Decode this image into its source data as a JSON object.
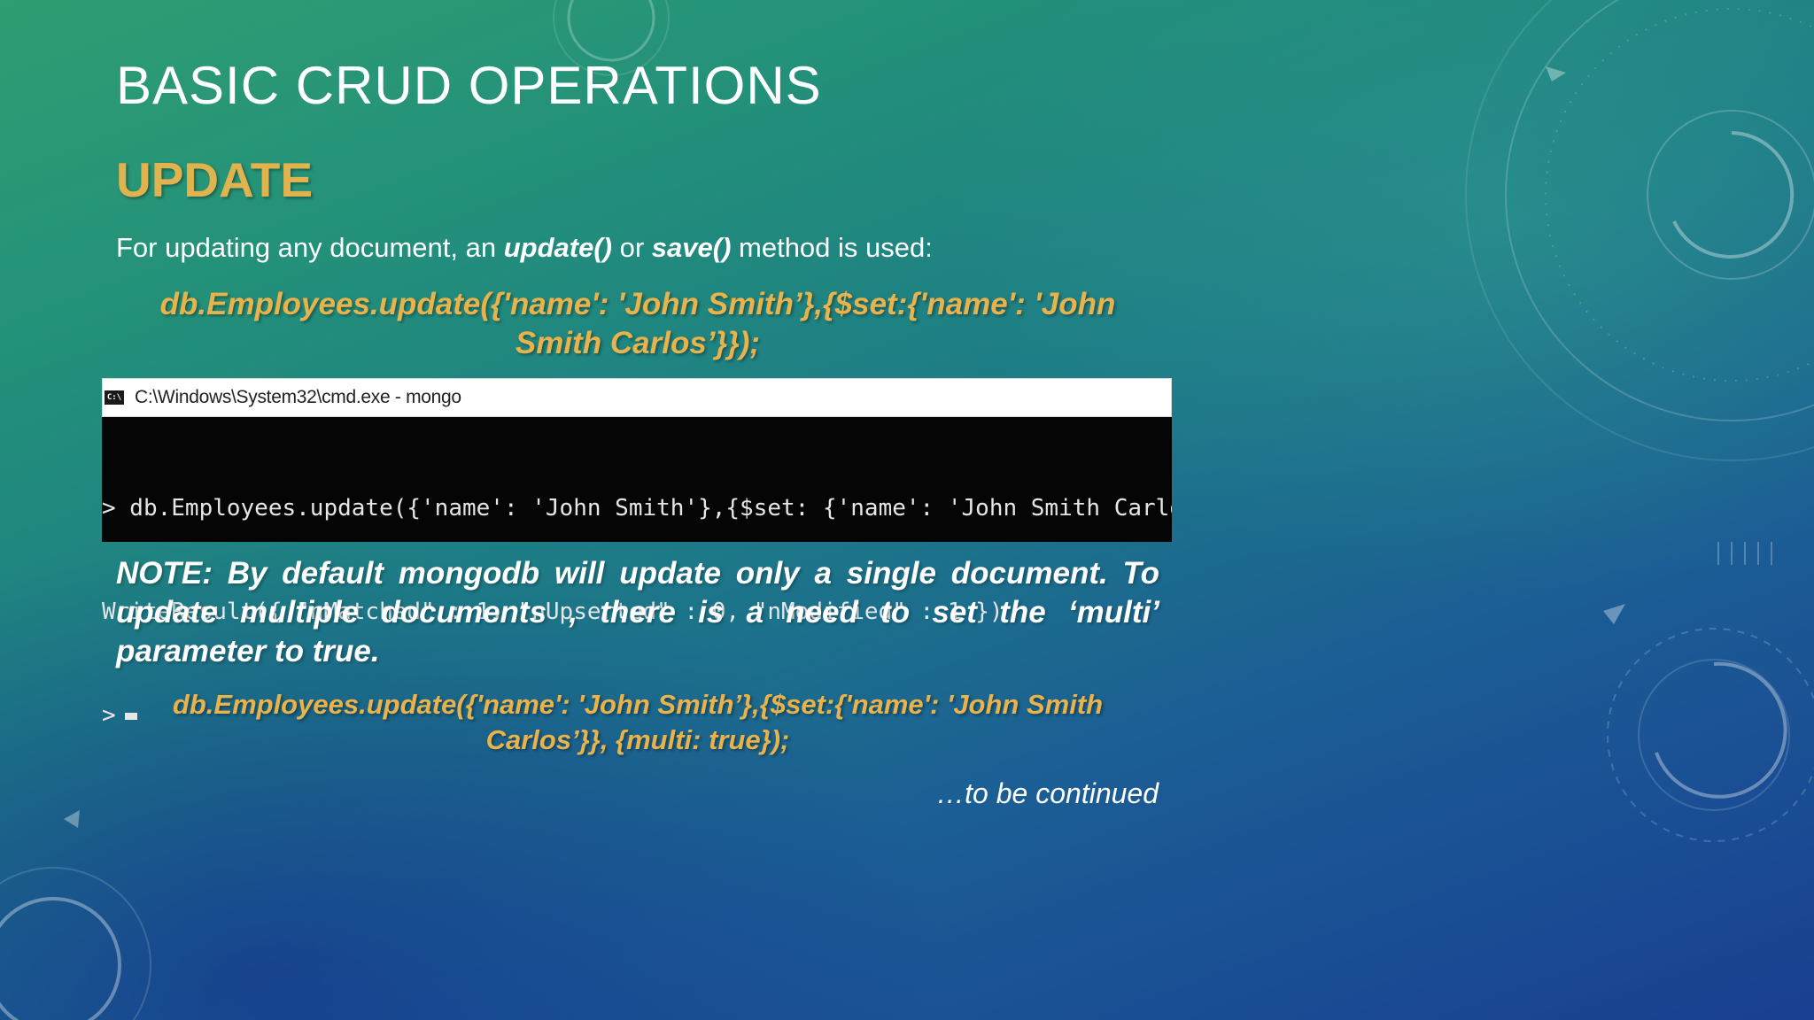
{
  "slide": {
    "title": "BASIC CRUD OPERATIONS",
    "subtitle": "UPDATE",
    "intro": {
      "prefix": "For updating any document, an ",
      "method1": "update()",
      "middle": " or ",
      "method2": "save()",
      "suffix": " method is used:"
    },
    "code_example_1": {
      "line1": "db.Employees.update({'name': 'John Smith’},{$set:{'name': 'John",
      "line2": "Smith Carlos’}});"
    },
    "terminal": {
      "icon_text": "C:\\",
      "window_title": "C:\\Windows\\System32\\cmd.exe - mongo",
      "lines": [
        "> db.Employees.update({'name': 'John Smith'},{$set: {'name': 'John Smith Carlos'}});",
        "WriteResult({ \"nMatched\" : 1, \"nUpserted\" : 0, \"nModified\" : 1 })",
        ">"
      ]
    },
    "note": "NOTE: By default mongodb will update only a single document. To update multiple documents , there is a need to set the  ‘multi’ parameter to true.",
    "code_example_2": {
      "line1": "db.Employees.update({'name': 'John Smith’},{$set:{'name': 'John Smith",
      "line2": "Carlos’}}, {multi: true});"
    },
    "footer": "…to be continued"
  },
  "colors": {
    "accent_gold": "#e0b34e",
    "text_white": "#ffffff",
    "terminal_bg": "#050505"
  }
}
